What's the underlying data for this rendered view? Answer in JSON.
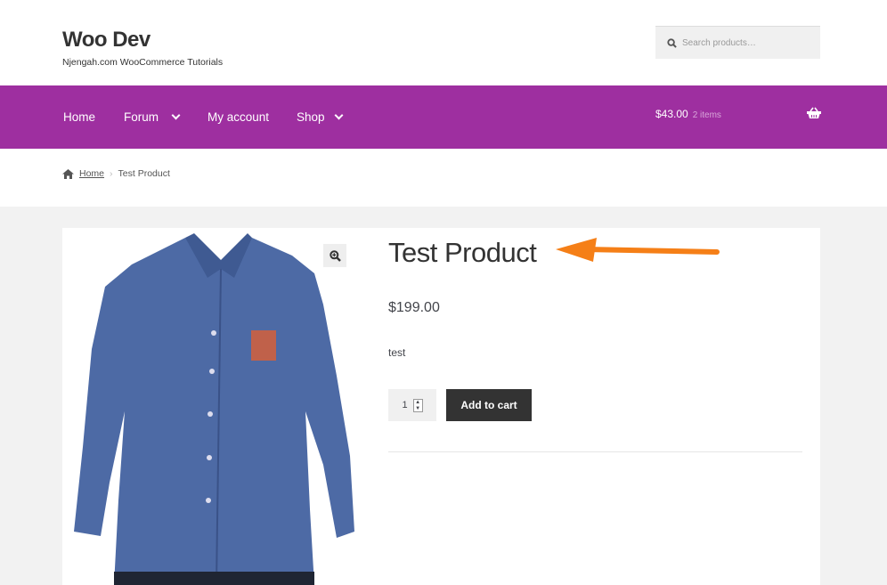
{
  "site": {
    "title": "Woo Dev",
    "tagline": "Njengah.com WooCommerce Tutorials"
  },
  "search": {
    "placeholder": "Search products…",
    "icon": "search-icon"
  },
  "nav": {
    "items": [
      {
        "label": "Home"
      },
      {
        "label": "Forum",
        "dropdown": true
      },
      {
        "label": "My account"
      },
      {
        "label": "Shop",
        "dropdown": true
      }
    ],
    "color": "#9e2fa0"
  },
  "cart": {
    "total": "$43.00",
    "count": "2 items",
    "icon": "basket-icon"
  },
  "breadcrumb": {
    "home": "Home",
    "current": "Test Product"
  },
  "product": {
    "title": "Test Product",
    "price": "$199.00",
    "description": "test",
    "quantity": "1",
    "add_to_cart": "Add to cart"
  },
  "annotation": {
    "arrow_color": "#f57f17"
  }
}
